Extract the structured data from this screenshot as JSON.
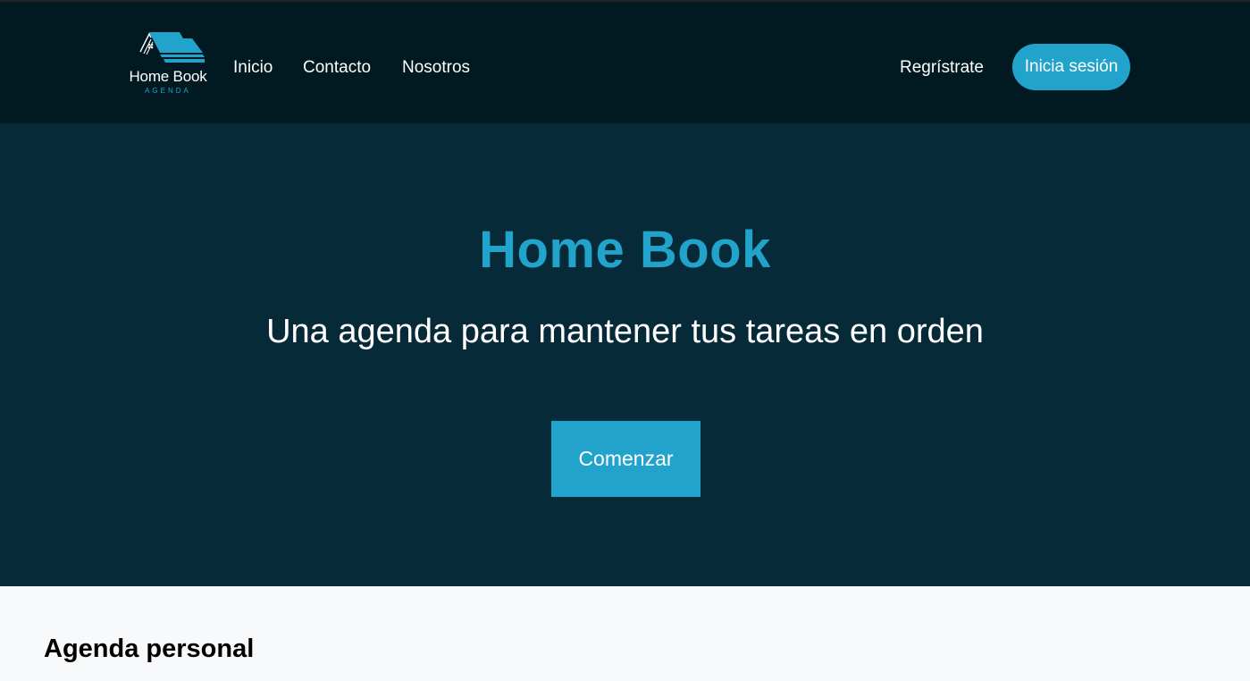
{
  "navbar": {
    "logo": {
      "name": "Home Book",
      "sub": "AGENDA",
      "icon": "house-book-logo"
    },
    "links": {
      "inicio": "Inicio",
      "contacto": "Contacto",
      "nosotros": "Nosotros",
      "registro": "Regrístrate"
    },
    "login_label": "Inicia sesión"
  },
  "hero": {
    "title": "Home Book",
    "subtitle": "Una agenda para mantener tus tareas en orden",
    "cta_label": "Comenzar"
  },
  "section": {
    "title": "Agenda personal"
  },
  "colors": {
    "accent": "#22a3cb",
    "navbar_bg": "#011921",
    "hero_bg": "#072a38",
    "page_bg": "#f8f9fb"
  }
}
